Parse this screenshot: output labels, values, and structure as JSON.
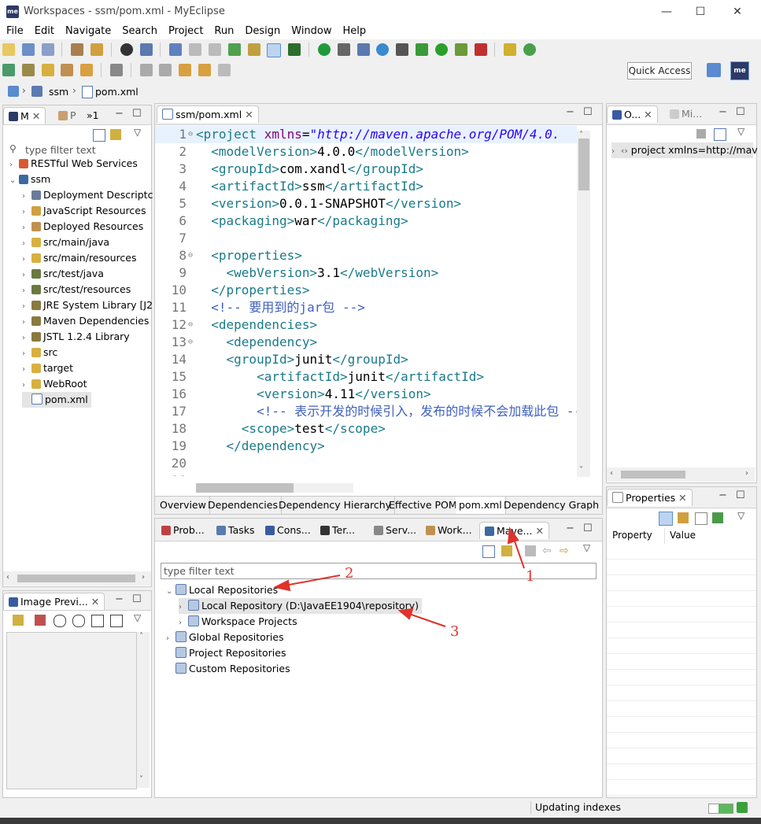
{
  "window": {
    "title": "Workspaces - ssm/pom.xml - MyEclipse",
    "logo": "me",
    "minimize": "—",
    "maximize": "☐",
    "close": "✕"
  },
  "menu": [
    "File",
    "Edit",
    "Navigate",
    "Search",
    "Project",
    "Run",
    "Design",
    "Window",
    "Help"
  ],
  "quick_access": "Quick Access",
  "breadcrumb": {
    "project": "ssm",
    "file": "pom.xml"
  },
  "explorer": {
    "tabs": [
      "M",
      "P",
      "»1"
    ],
    "filter_placeholder": "type filter text",
    "items": [
      {
        "label": "RESTful Web Services",
        "indent": 0,
        "arrow": "›"
      },
      {
        "label": "ssm",
        "indent": 0,
        "arrow": "⌄"
      },
      {
        "label": "Deployment Descriptc",
        "indent": 1,
        "arrow": "›"
      },
      {
        "label": "JavaScript Resources",
        "indent": 1,
        "arrow": "›"
      },
      {
        "label": "Deployed Resources",
        "indent": 1,
        "arrow": "›"
      },
      {
        "label": "src/main/java",
        "indent": 1,
        "arrow": "›"
      },
      {
        "label": "src/main/resources",
        "indent": 1,
        "arrow": "›"
      },
      {
        "label": "src/test/java",
        "indent": 1,
        "arrow": "›"
      },
      {
        "label": "src/test/resources",
        "indent": 1,
        "arrow": "›"
      },
      {
        "label": "JRE System Library [J2",
        "indent": 1,
        "arrow": "›"
      },
      {
        "label": "Maven Dependencies",
        "indent": 1,
        "arrow": "›"
      },
      {
        "label": "JSTL 1.2.4 Library",
        "indent": 1,
        "arrow": "›"
      },
      {
        "label": "src",
        "indent": 1,
        "arrow": "›"
      },
      {
        "label": "target",
        "indent": 1,
        "arrow": "›"
      },
      {
        "label": "WebRoot",
        "indent": 1,
        "arrow": "›"
      },
      {
        "label": "pom.xml",
        "indent": 1,
        "arrow": ""
      }
    ]
  },
  "image_preview": {
    "title": "Image Previ..."
  },
  "editor": {
    "tab": "ssm/pom.xml",
    "lines": [
      {
        "n": "1",
        "fold": "⊖",
        "html": "<span class=\"tag\">&lt;project</span> <span class=\"attr\">xmlns</span>=<span class=\"val\">\"http://maven.apache.org/POM/4.0.</span>"
      },
      {
        "n": "2",
        "fold": "",
        "html": "  <span class=\"tag\">&lt;modelVersion&gt;</span>4.0.0<span class=\"tag\">&lt;/modelVersion&gt;</span>"
      },
      {
        "n": "3",
        "fold": "",
        "html": "  <span class=\"tag\">&lt;groupId&gt;</span>com.xandl<span class=\"tag\">&lt;/groupId&gt;</span>"
      },
      {
        "n": "4",
        "fold": "",
        "html": "  <span class=\"tag\">&lt;artifactId&gt;</span>ssm<span class=\"tag\">&lt;/artifactId&gt;</span>"
      },
      {
        "n": "5",
        "fold": "",
        "html": "  <span class=\"tag\">&lt;version&gt;</span>0.0.1-SNAPSHOT<span class=\"tag\">&lt;/version&gt;</span>"
      },
      {
        "n": "6",
        "fold": "",
        "html": "  <span class=\"tag\">&lt;packaging&gt;</span>war<span class=\"tag\">&lt;/packaging&gt;</span>"
      },
      {
        "n": "7",
        "fold": "",
        "html": ""
      },
      {
        "n": "8",
        "fold": "⊖",
        "html": "  <span class=\"tag\">&lt;properties&gt;</span>"
      },
      {
        "n": "9",
        "fold": "",
        "html": "    <span class=\"tag\">&lt;webVersion&gt;</span>3.1<span class=\"tag\">&lt;/webVersion&gt;</span>"
      },
      {
        "n": "10",
        "fold": "",
        "html": "  <span class=\"tag\">&lt;/properties&gt;</span>"
      },
      {
        "n": "11",
        "fold": "",
        "html": "  <span class=\"cmt\">&lt;!-- 要用到的jar包 --&gt;</span>"
      },
      {
        "n": "12",
        "fold": "⊖",
        "html": "  <span class=\"tag\">&lt;dependencies&gt;</span>"
      },
      {
        "n": "13",
        "fold": "⊖",
        "html": "    <span class=\"tag\">&lt;dependency&gt;</span>"
      },
      {
        "n": "14",
        "fold": "",
        "html": "    <span class=\"tag\">&lt;groupId&gt;</span>junit<span class=\"tag\">&lt;/groupId&gt;</span>"
      },
      {
        "n": "15",
        "fold": "",
        "html": "        <span class=\"tag\">&lt;artifactId&gt;</span>junit<span class=\"tag\">&lt;/artifactId&gt;</span>"
      },
      {
        "n": "16",
        "fold": "",
        "html": "        <span class=\"tag\">&lt;version&gt;</span>4.11<span class=\"tag\">&lt;/version&gt;</span>"
      },
      {
        "n": "17",
        "fold": "",
        "html": "        <span class=\"cmt\">&lt;!-- 表示开发的时候引入，发布的时候不会加载此包 --&gt;</span>"
      },
      {
        "n": "18",
        "fold": "",
        "html": "      <span class=\"tag\">&lt;scope&gt;</span>test<span class=\"tag\">&lt;/scope&gt;</span>"
      },
      {
        "n": "19",
        "fold": "",
        "html": "    <span class=\"tag\">&lt;/dependency&gt;</span>"
      },
      {
        "n": "20",
        "fold": "",
        "html": ""
      },
      {
        "n": "21",
        "fold": "",
        "html": ""
      }
    ],
    "bottom_tabs": [
      "Overview",
      "Dependencies",
      "Dependency Hierarchy",
      "Effective POM",
      "pom.xml",
      "Dependency Graph"
    ]
  },
  "outline": {
    "tabs": [
      "O...",
      "Mi..."
    ],
    "item": "project xmlns=http://mav"
  },
  "properties": {
    "title": "Properties",
    "col_property": "Property",
    "col_value": "Value"
  },
  "bottom_panel": {
    "tabs": [
      "Prob...",
      "Tasks",
      "Cons...",
      "Ter...",
      "Serv...",
      "Work...",
      "Mave..."
    ],
    "filter_placeholder": "type filter text",
    "tree": [
      {
        "label": "Local Repositories",
        "indent": 0,
        "arrow": "⌄"
      },
      {
        "label": "Local Repository (D:\\JavaEE1904\\repository)",
        "indent": 1,
        "arrow": "›"
      },
      {
        "label": "Workspace Projects",
        "indent": 1,
        "arrow": "›"
      },
      {
        "label": "Global Repositories",
        "indent": 0,
        "arrow": "›"
      },
      {
        "label": "Project Repositories",
        "indent": 0,
        "arrow": ""
      },
      {
        "label": "Custom Repositories",
        "indent": 0,
        "arrow": ""
      }
    ]
  },
  "annotations": {
    "a1": "1",
    "a2": "2",
    "a3": "3"
  },
  "status": {
    "text": "Updating indexes"
  }
}
